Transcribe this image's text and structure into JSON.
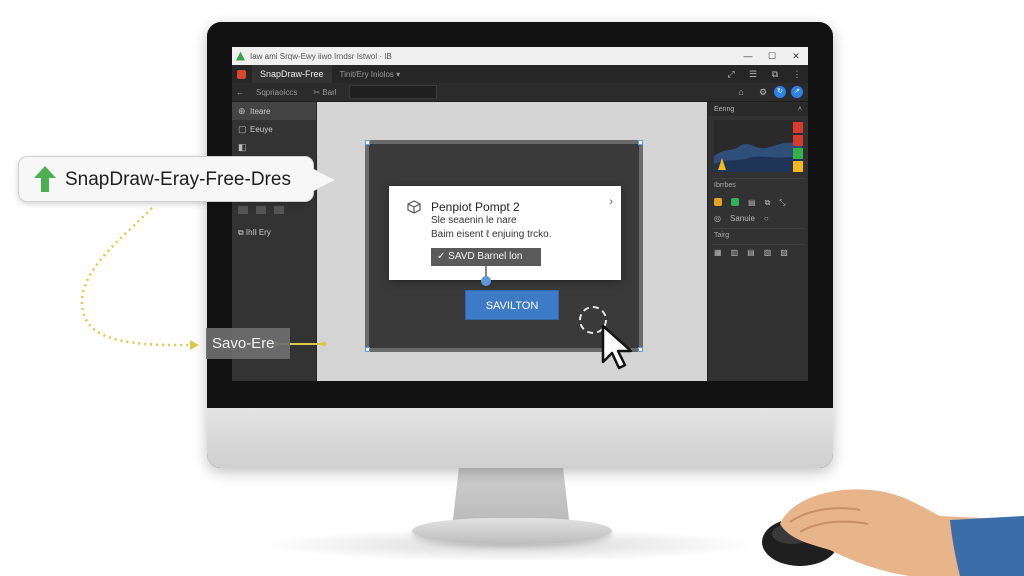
{
  "window": {
    "title": "Iaw ami Srqw-Ewy iiwo Irndsr Istwol · IB",
    "controls": {
      "minimize": "—",
      "maximize": "☐",
      "close": "✕"
    }
  },
  "tabs": {
    "app_tab": "SnapDraw-Free",
    "second_tab": "Tinit/Ery Iniolos ▾",
    "icons": [
      "⤢",
      "☰",
      "⧉",
      "⋮"
    ]
  },
  "toolbar": {
    "back": "←",
    "nav_label": "Sqpriaoiccs",
    "tool_label": "✂ Barl",
    "address_value": ""
  },
  "sidebar": {
    "items": [
      {
        "icon": "⊕",
        "label": "Iteare"
      },
      {
        "icon": "▢",
        "label": "Eeuye"
      },
      {
        "icon": "◧",
        "label": ""
      }
    ],
    "footer_label": "⧉ IhIl Ery"
  },
  "dialog": {
    "title": "Penpiot Pompt 2",
    "close": "›",
    "line1": "Sle seaenin le nare",
    "line2": "Baim eisent ℓ enjuing trcko.",
    "check_button": "✓ SAVD Barnel lon"
  },
  "save_button": {
    "label": "SAVILTON"
  },
  "right_panel": {
    "header": "Eenng",
    "section1": "Ibrrbes",
    "section2": "Sanuie",
    "section3": "Tairg",
    "swatch_colors": [
      "#d83a2c",
      "#d83a2c",
      "#33b24a",
      "#f2b81c"
    ]
  },
  "callout": {
    "text": "SnapDraw-Eray-Free-Dres"
  },
  "save_label": {
    "text": "Savo-Ere"
  },
  "colors": {
    "accent_blue": "#3e7bc6",
    "arrow_green": "#4caf50",
    "connector_yellow": "#d9c94a"
  }
}
